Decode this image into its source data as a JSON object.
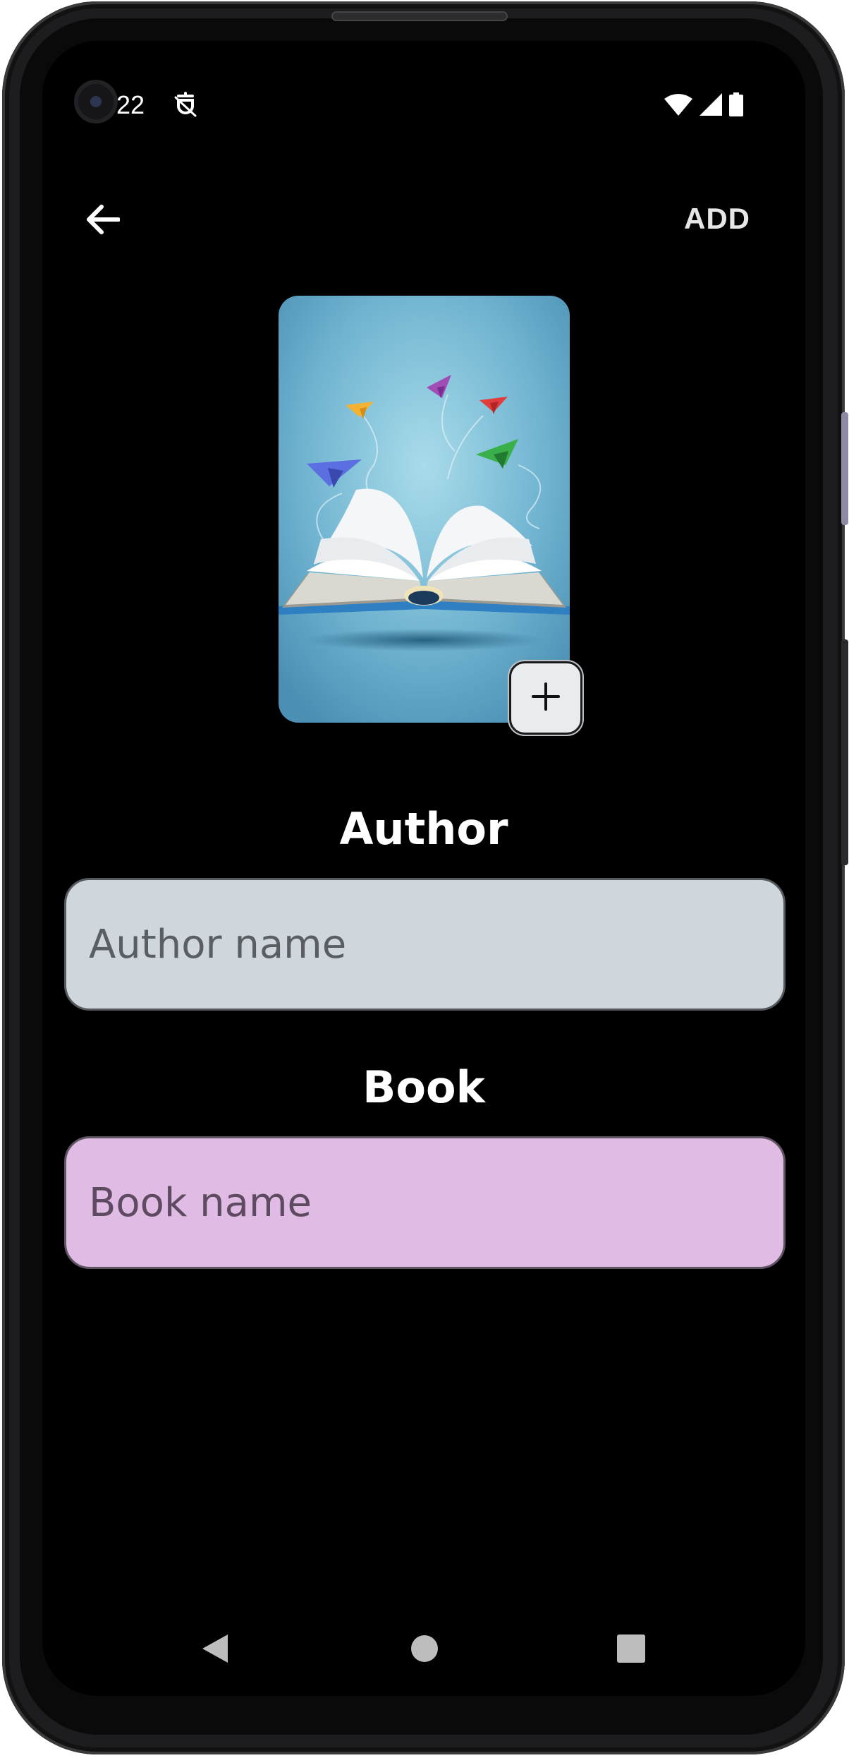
{
  "status_bar": {
    "time": "22",
    "icons": [
      "camera-punch-hole",
      "notification-icon",
      "wifi-icon",
      "signal-icon",
      "battery-icon"
    ]
  },
  "app_bar": {
    "back_icon": "arrow-back-icon",
    "action_label": "ADD"
  },
  "cover": {
    "image": "open-book-with-paper-planes",
    "add_icon": "plus-icon"
  },
  "form": {
    "author_label": "Author",
    "author_placeholder": "Author name",
    "author_value": "",
    "book_label": "Book",
    "book_placeholder": "Book name",
    "book_value": ""
  },
  "nav_bar": {
    "back_icon": "nav-back-icon",
    "home_icon": "nav-home-icon",
    "recents_icon": "nav-recents-icon"
  },
  "colors": {
    "background": "#000000",
    "author_field": "#cfd7dd",
    "book_field": "#e0bbe4",
    "text_primary": "#ffffff"
  }
}
